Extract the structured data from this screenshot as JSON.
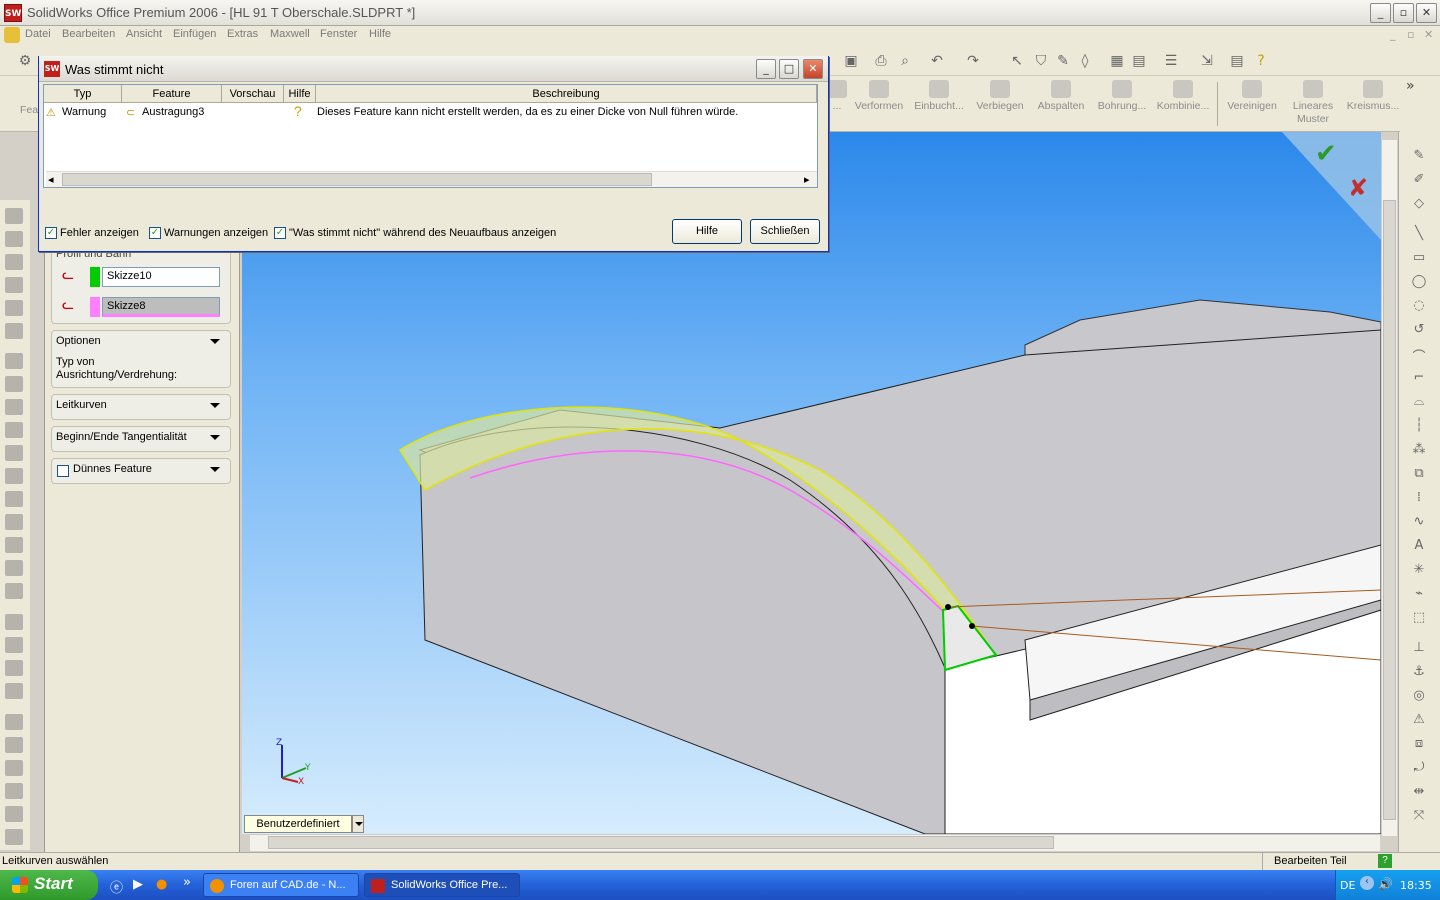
{
  "window": {
    "title": "SolidWorks Office Premium 2006 - [HL 91 T Oberschale.SLDPRT *]",
    "icon_text": "SW"
  },
  "menu": [
    "Datei",
    "Bearbeiten",
    "Ansicht",
    "Einfügen",
    "Extras",
    "Maxwell",
    "Fenster",
    "Hilfe"
  ],
  "command_bar": {
    "first_label": "Fea",
    "items": [
      {
        "label": "...",
        "icon": "partial-icon"
      },
      {
        "label": "Verformen",
        "icon": "deform-icon"
      },
      {
        "label": "Einbucht...",
        "icon": "indent-icon"
      },
      {
        "label": "Verbiegen",
        "icon": "flex-icon"
      },
      {
        "label": "Abspalten",
        "icon": "split-icon"
      },
      {
        "label": "Bohrung...",
        "icon": "hole-icon"
      },
      {
        "label": "Kombinie...",
        "icon": "combine-icon"
      },
      {
        "label": "Vereinigen",
        "icon": "join-icon"
      },
      {
        "label": "Lineares Muster",
        "icon": "linear-pattern-icon"
      },
      {
        "label": "Kreismus...",
        "icon": "circular-pattern-icon"
      }
    ]
  },
  "dialog": {
    "title": "Was stimmt nicht",
    "columns": [
      "Typ",
      "Feature",
      "Vorschau",
      "Hilfe",
      "Beschreibung"
    ],
    "rows": [
      {
        "typ": "Warnung",
        "feature": "Austragung3",
        "vorschau": "",
        "hilfe_icon": "question-icon",
        "beschreibung": "Dieses Feature kann nicht erstellt werden, da es zu einer Dicke von Null führen würde."
      }
    ],
    "checkboxes": [
      {
        "label": "Fehler anzeigen",
        "checked": true
      },
      {
        "label": "Warnungen anzeigen",
        "checked": true
      },
      {
        "label": "\"Was stimmt nicht\" während des Neuaufbaus anzeigen",
        "checked": true
      }
    ],
    "buttons": {
      "help": "Hilfe",
      "close": "Schließen"
    }
  },
  "property_manager": {
    "profile_header": "Profil und Bahn",
    "profile": {
      "value": "Skizze10",
      "color": "#00cc00"
    },
    "path": {
      "value": "Skizze8",
      "color": "#ff80ff"
    },
    "options": {
      "header": "Optionen",
      "label_line1": "Typ von",
      "label_line2": "Ausrichtung/Verdrehung:"
    },
    "guide_curves": "Leitkurven",
    "tangency": "Beginn/Ende Tangentialität",
    "thin_feature": {
      "label": "Dünnes Feature",
      "checked": false
    }
  },
  "viewport": {
    "view_orientation": "Benutzerdefiniert",
    "triad": {
      "z": "Z",
      "y": "Y",
      "x": "X"
    },
    "confirm_icon": "check-icon",
    "cancel_icon": "x-icon"
  },
  "status": {
    "left": "Leitkurven auswählen",
    "right": "Bearbeiten Teil"
  },
  "taskbar": {
    "start": "Start",
    "items": [
      {
        "label": "Foren auf CAD.de - N...",
        "icon": "firefox-icon"
      },
      {
        "label": "SolidWorks Office Pre...",
        "icon": "solidworks-icon"
      }
    ],
    "lang": "DE",
    "clock": "18:35",
    "overflow": "»"
  }
}
